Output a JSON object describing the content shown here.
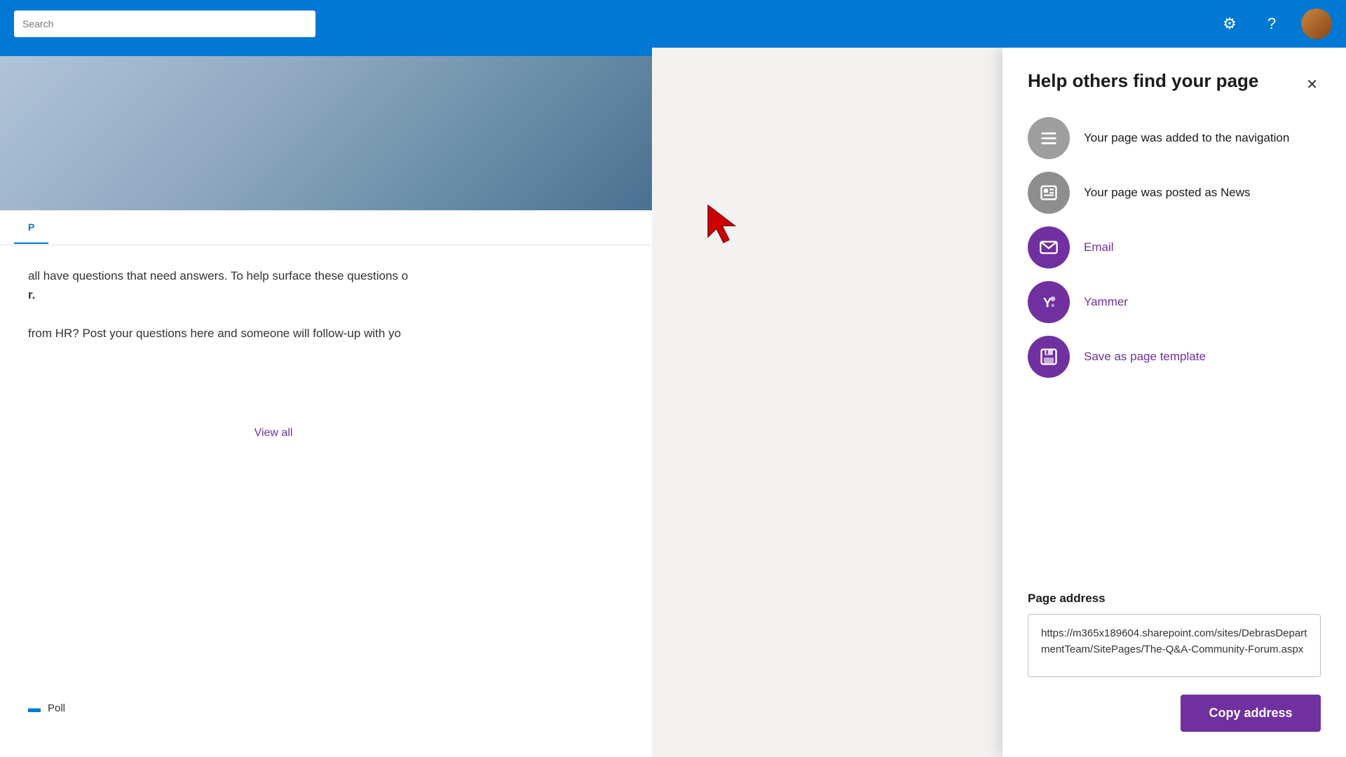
{
  "topNav": {
    "search": {
      "placeholder": "Search"
    },
    "icons": {
      "settings": "⚙",
      "help": "?",
      "avatar_alt": "User avatar"
    }
  },
  "pageTab": {
    "label": "P"
  },
  "pageContent": {
    "line1": "all have questions that need answers.  To help surface these questions o",
    "line2": "r.",
    "line3": "from HR?  Post your questions here and someone will follow-up with yo",
    "viewAll": "View all",
    "bottomItem": "Poll"
  },
  "panel": {
    "title": "Help others find your page",
    "close": "✕",
    "items": [
      {
        "id": "navigation",
        "label": "Your page was added to the navigation",
        "iconType": "gray",
        "iconSymbol": "nav"
      },
      {
        "id": "news",
        "label": "Your page was posted as News",
        "iconType": "gray2",
        "iconSymbol": "news"
      },
      {
        "id": "email",
        "label": "Email",
        "iconType": "purple",
        "iconSymbol": "email",
        "purple": true
      },
      {
        "id": "yammer",
        "label": "Yammer",
        "iconType": "purple",
        "iconSymbol": "yammer",
        "purple": true
      },
      {
        "id": "template",
        "label": "Save as page template",
        "iconType": "purple",
        "iconSymbol": "save",
        "purple": true
      }
    ],
    "pageAddress": {
      "label": "Page address",
      "url": "https://m365x189604.sharepoint.com/sites/DebrasDepartmentTeam/SitePages/The-Q&A-Community-Forum.aspx"
    },
    "copyButton": "Copy address"
  }
}
